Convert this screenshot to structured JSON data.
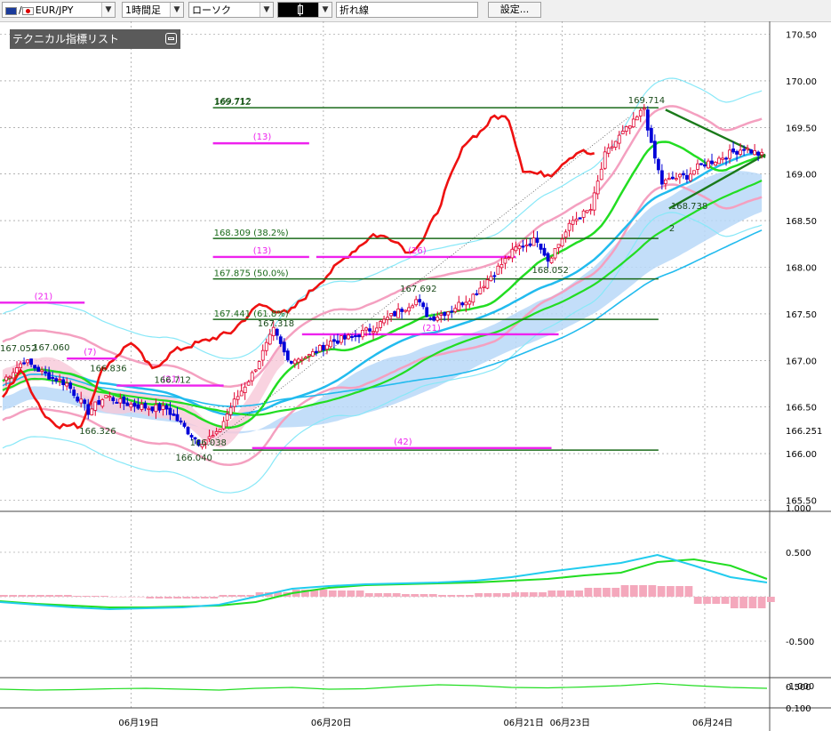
{
  "toolbar": {
    "pair": "EUR/JPY",
    "timeframe": "1時間足",
    "chart_type": "ローソク",
    "line_label": "折れ線",
    "settings": "設定..."
  },
  "indicator_panel": {
    "title": "テクニカル指標リスト"
  },
  "colors": {
    "candle_up": "#e0002e",
    "candle_down": "#0000d8",
    "line_red": "#ee1111",
    "ma_green": "#22dd22",
    "ma_blue": "#22bbee",
    "band_pink": "#f4a0c0",
    "band_cyan": "#88e8f8",
    "cloud": "#b8d8f8",
    "fib_line": "#1a6a1a",
    "magenta": "#ee22ee"
  },
  "chart_data": [
    {
      "type": "candlestick",
      "title": "",
      "ylim": [
        165.5,
        170.6
      ],
      "y_ticks": [
        "170.50",
        "170.00",
        "169.50",
        "169.00",
        "168.50",
        "168.00",
        "167.50",
        "167.00",
        "166.50",
        "166.251",
        "166.00",
        "165.50"
      ],
      "x_labels": [
        {
          "label": "06月19日",
          "index": 36
        },
        {
          "label": "06月20日",
          "index": 90
        },
        {
          "label": "06月21日",
          "index": 144
        },
        {
          "label": "06月23日",
          "index": 157
        },
        {
          "label": "06月24日",
          "index": 197
        }
      ],
      "bar_count": 214,
      "price_labels": [
        {
          "text": "169.712",
          "index": 60,
          "value": 169.712,
          "pos": "above-left"
        },
        {
          "text": "169.714",
          "index": 180,
          "value": 169.714,
          "pos": "above"
        },
        {
          "text": "168.738",
          "index": 192,
          "value": 168.738,
          "pos": "below"
        },
        {
          "text": "168.052",
          "index": 153,
          "value": 168.052,
          "pos": "below"
        },
        {
          "text": "167.692",
          "index": 116,
          "value": 167.692,
          "pos": "above"
        },
        {
          "text": "167.318",
          "index": 76,
          "value": 167.318,
          "pos": "above"
        },
        {
          "text": "167.052",
          "index": 1,
          "value": 167.052,
          "pos": "above"
        },
        {
          "text": "167.060",
          "index": 13,
          "value": 167.06,
          "pos": "above"
        },
        {
          "text": "166.836",
          "index": 29,
          "value": 166.836,
          "pos": "above"
        },
        {
          "text": "166.712",
          "index": 47,
          "value": 166.712,
          "pos": "above"
        },
        {
          "text": "166.326",
          "index": 26,
          "value": 166.326,
          "pos": "below"
        },
        {
          "text": "166.038",
          "index": 57,
          "value": 166.038,
          "pos": "above"
        },
        {
          "text": "166.040",
          "index": 53,
          "value": 166.04,
          "pos": "below"
        },
        {
          "text": "2",
          "index": 186,
          "value": 168.5,
          "pos": "right"
        }
      ],
      "fib_levels": [
        {
          "label": "169.712",
          "value": 169.712,
          "from": 59,
          "to": 184
        },
        {
          "label": "168.309 (38.2%)",
          "value": 168.309,
          "from": 59,
          "to": 184
        },
        {
          "label": "167.875 (50.0%)",
          "value": 167.875,
          "from": 59,
          "to": 184
        },
        {
          "label": "167.441 (61.8%)",
          "value": 167.441,
          "from": 59,
          "to": 184
        },
        {
          "label": "",
          "value": 166.038,
          "from": 59,
          "to": 184
        }
      ],
      "period_labels": [
        {
          "text": "(13)",
          "value": 169.33,
          "from": 59,
          "to": 86
        },
        {
          "text": "(13)",
          "value": 168.11,
          "from": 59,
          "to": 86
        },
        {
          "text": "(26)",
          "value": 168.11,
          "from": 88,
          "to": 144
        },
        {
          "text": "(21)",
          "value": 167.62,
          "from": -2,
          "to": 23
        },
        {
          "text": "(7)",
          "value": 167.02,
          "from": 18,
          "to": 32
        },
        {
          "text": "(21)",
          "value": 166.73,
          "from": 32,
          "to": 62
        },
        {
          "text": "(21)",
          "value": 167.28,
          "from": 84,
          "to": 156
        },
        {
          "text": "(42)",
          "value": 166.06,
          "from": 70,
          "to": 154
        }
      ],
      "triangle": [
        {
          "from": [
            186,
            169.69
          ],
          "to": [
            214,
            169.18
          ]
        },
        {
          "from": [
            187,
            168.63
          ],
          "to": [
            214,
            169.21
          ]
        }
      ]
    },
    {
      "type": "line",
      "title": "",
      "ylim": [
        -1.0,
        1.0
      ],
      "y_ticks": [
        "1.000",
        "0.500",
        "",
        "-0.500",
        "-1.000"
      ],
      "series": [
        {
          "color": "#22dd22",
          "values": [
            -0.05,
            -0.08,
            -0.1,
            -0.12,
            -0.12,
            -0.11,
            -0.1,
            -0.06,
            0.04,
            0.1,
            0.13,
            0.14,
            0.15,
            0.16,
            0.18,
            0.2,
            0.24,
            0.27,
            0.39,
            0.42,
            0.35,
            0.2
          ]
        },
        {
          "color": "#22ccee",
          "values": [
            -0.06,
            -0.09,
            -0.12,
            -0.14,
            -0.13,
            -0.12,
            -0.09,
            0.0,
            0.09,
            0.12,
            0.14,
            0.15,
            0.16,
            0.18,
            0.22,
            0.28,
            0.33,
            0.38,
            0.47,
            0.35,
            0.22,
            0.16
          ]
        }
      ],
      "histogram": [
        0.02,
        0.02,
        0.01,
        0.0,
        -0.02,
        -0.02,
        0.02,
        0.05,
        0.08,
        0.07,
        0.04,
        0.03,
        0.02,
        0.04,
        0.05,
        0.07,
        0.1,
        0.13,
        0.12,
        -0.08,
        -0.13,
        -0.06
      ]
    },
    {
      "type": "line",
      "title": "",
      "ylim": [
        0.0,
        1.0
      ],
      "y_ticks": [
        "0.500",
        "0.100"
      ],
      "series": [
        {
          "color": "#22dd22",
          "values": [
            0.22,
            0.2,
            0.21,
            0.23,
            0.24,
            0.22,
            0.2,
            0.24,
            0.26,
            0.22,
            0.23,
            0.28,
            0.32,
            0.3,
            0.26,
            0.25,
            0.27,
            0.3,
            0.35,
            0.3,
            0.26,
            0.24
          ]
        }
      ]
    }
  ]
}
